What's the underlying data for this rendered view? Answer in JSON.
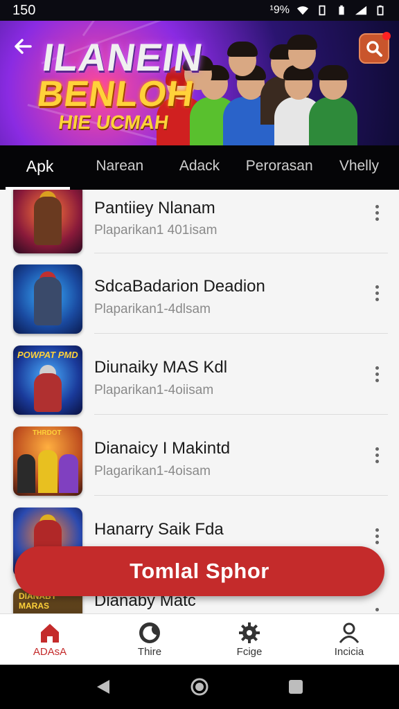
{
  "status_bar": {
    "time": "150",
    "indicator": "¹9%"
  },
  "banner": {
    "title_line1": "ILANEIN",
    "title_line2": "BENLOH",
    "title_line3": "HIE UCMAH"
  },
  "tabs": [
    {
      "label": "Apk",
      "active": true
    },
    {
      "label": "Narean",
      "active": false
    },
    {
      "label": "Adack",
      "active": false
    },
    {
      "label": "Perorasan",
      "active": false
    },
    {
      "label": "Vhelly",
      "active": false
    }
  ],
  "items": [
    {
      "title": "Pantiiey Nlanam",
      "subtitle": "Plaparikan1 401isam"
    },
    {
      "title": "SdcaBadarion Deadion",
      "subtitle": "Plaparikan1-4dlsam"
    },
    {
      "title": "Diunaiky MAS Kdl",
      "subtitle": "Plaparikan1-4oiisam"
    },
    {
      "title": "Dianaicy I Makintd",
      "subtitle": "Plagarikan1-4oisam"
    },
    {
      "title": "Hanarry Saik Fda",
      "subtitle": ""
    },
    {
      "title": "Dianaby Matc",
      "subtitle": ""
    }
  ],
  "thumb_labels": [
    "POWPAT PMD",
    "THRDOT",
    "DIANABY MARAS"
  ],
  "cta": {
    "label": "Tomlal Sphor"
  },
  "bottom_nav": [
    {
      "label": "ADAsA",
      "icon": "home-icon",
      "active": true
    },
    {
      "label": "Thire",
      "icon": "moon-icon",
      "active": false
    },
    {
      "label": "Fcige",
      "icon": "gear-icon",
      "active": false
    },
    {
      "label": "Incicia",
      "icon": "person-icon",
      "active": false
    }
  ],
  "colors": {
    "accent": "#c42b2b",
    "tabbar_bg": "#050507",
    "banner_gold": "#ffd23a"
  }
}
